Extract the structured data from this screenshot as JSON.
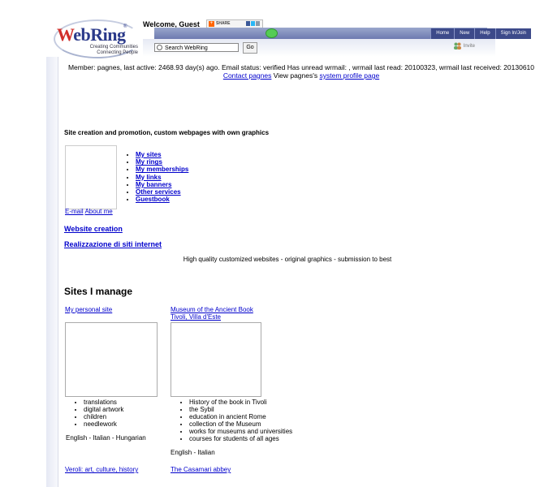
{
  "header": {
    "logo_text_w": "W",
    "logo_text_rest": "ebRing",
    "logo_reg": "®",
    "logo_tagline_1": "Creating Communities",
    "logo_tagline_2": "Connecting People",
    "welcome": "Welcome, Guest",
    "share_label": "SHARE",
    "search_placeholder": "Search WebRing",
    "go_label": "Go",
    "invite_label": "Invite"
  },
  "nav": {
    "tabs": [
      "Home",
      "New",
      "Help",
      "Sign In/Join"
    ]
  },
  "status": {
    "text": "Member: pagnes, last active: 2468.93 day(s) ago. Email status: verified Has unread wrmail: , wrmail last read: 20100323, wrmail last received: 20130610",
    "contact_link": "Contact pagnes",
    "middle_text": " View pagnes's ",
    "system_link": "system profile page"
  },
  "profile": {
    "headline": "Site creation and promotion, custom webpages with own graphics",
    "email_link": "E-mail",
    "about_link": "About me",
    "menu": [
      "My sites",
      "My rings",
      "My memberships",
      "My links",
      "My banners",
      "Other services",
      "Guestbook"
    ]
  },
  "links": {
    "website_creation": "Website creation",
    "realizzazione": "Realizzazione di siti internet"
  },
  "promo": "High quality customized websites - original graphics - submission to best",
  "sites": {
    "title": "Sites I manage",
    "site1": {
      "title": "My personal site",
      "items": [
        "translations",
        "digital artwork",
        "children",
        "needlework"
      ],
      "lang": "English - Italian - Hungarian"
    },
    "site2": {
      "title_line1": "Museum of the Ancient Book",
      "title_line2": "Tivoli, Villa d'Este",
      "items": [
        "History of the book in Tivoli",
        "the Sybil",
        "education in ancient Rome",
        "collection of the Museum",
        "works for museums and universities",
        "courses for students of all ages"
      ],
      "lang": "English - Italian"
    },
    "site3": {
      "title": "Veroli: art, culture, history"
    },
    "site4": {
      "title": "The Casamari abbey"
    }
  },
  "colors": {
    "nav_tab": "#3d4a8a",
    "nav_bar": "#7f8bbd",
    "link": "#0000cc",
    "logo_blue": "#2b3a8a",
    "logo_red": "#d1302b"
  }
}
